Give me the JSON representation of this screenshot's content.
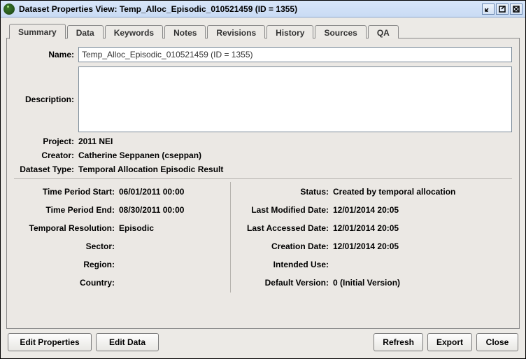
{
  "window": {
    "title": "Dataset Properties View: Temp_Alloc_Episodic_010521459 (ID = 1355)"
  },
  "tabs": {
    "items": [
      "Summary",
      "Data",
      "Keywords",
      "Notes",
      "Revisions",
      "History",
      "Sources",
      "QA"
    ],
    "active": "Summary"
  },
  "summary": {
    "name_label": "Name:",
    "name_value": "Temp_Alloc_Episodic_010521459 (ID = 1355)",
    "description_label": "Description:",
    "description_value": "",
    "project_label": "Project:",
    "project_value": "2011 NEI",
    "creator_label": "Creator:",
    "creator_value": "Catherine Seppanen (cseppan)",
    "dataset_type_label": "Dataset Type:",
    "dataset_type_value": "Temporal Allocation Episodic Result",
    "left": {
      "time_period_start_label": "Time Period Start:",
      "time_period_start_value": "06/01/2011 00:00",
      "time_period_end_label": "Time Period End:",
      "time_period_end_value": "08/30/2011 00:00",
      "temporal_resolution_label": "Temporal Resolution:",
      "temporal_resolution_value": "Episodic",
      "sector_label": "Sector:",
      "sector_value": "",
      "region_label": "Region:",
      "region_value": "",
      "country_label": "Country:",
      "country_value": ""
    },
    "right": {
      "status_label": "Status:",
      "status_value": "Created by temporal allocation",
      "last_modified_label": "Last Modified Date:",
      "last_modified_value": "12/01/2014 20:05",
      "last_accessed_label": "Last Accessed Date:",
      "last_accessed_value": "12/01/2014 20:05",
      "creation_date_label": "Creation Date:",
      "creation_date_value": "12/01/2014 20:05",
      "intended_use_label": "Intended Use:",
      "intended_use_value": "",
      "default_version_label": "Default Version:",
      "default_version_value": "0 (Initial Version)"
    }
  },
  "buttons": {
    "edit_properties": "Edit Properties",
    "edit_data": "Edit Data",
    "refresh": "Refresh",
    "export": "Export",
    "close": "Close"
  }
}
